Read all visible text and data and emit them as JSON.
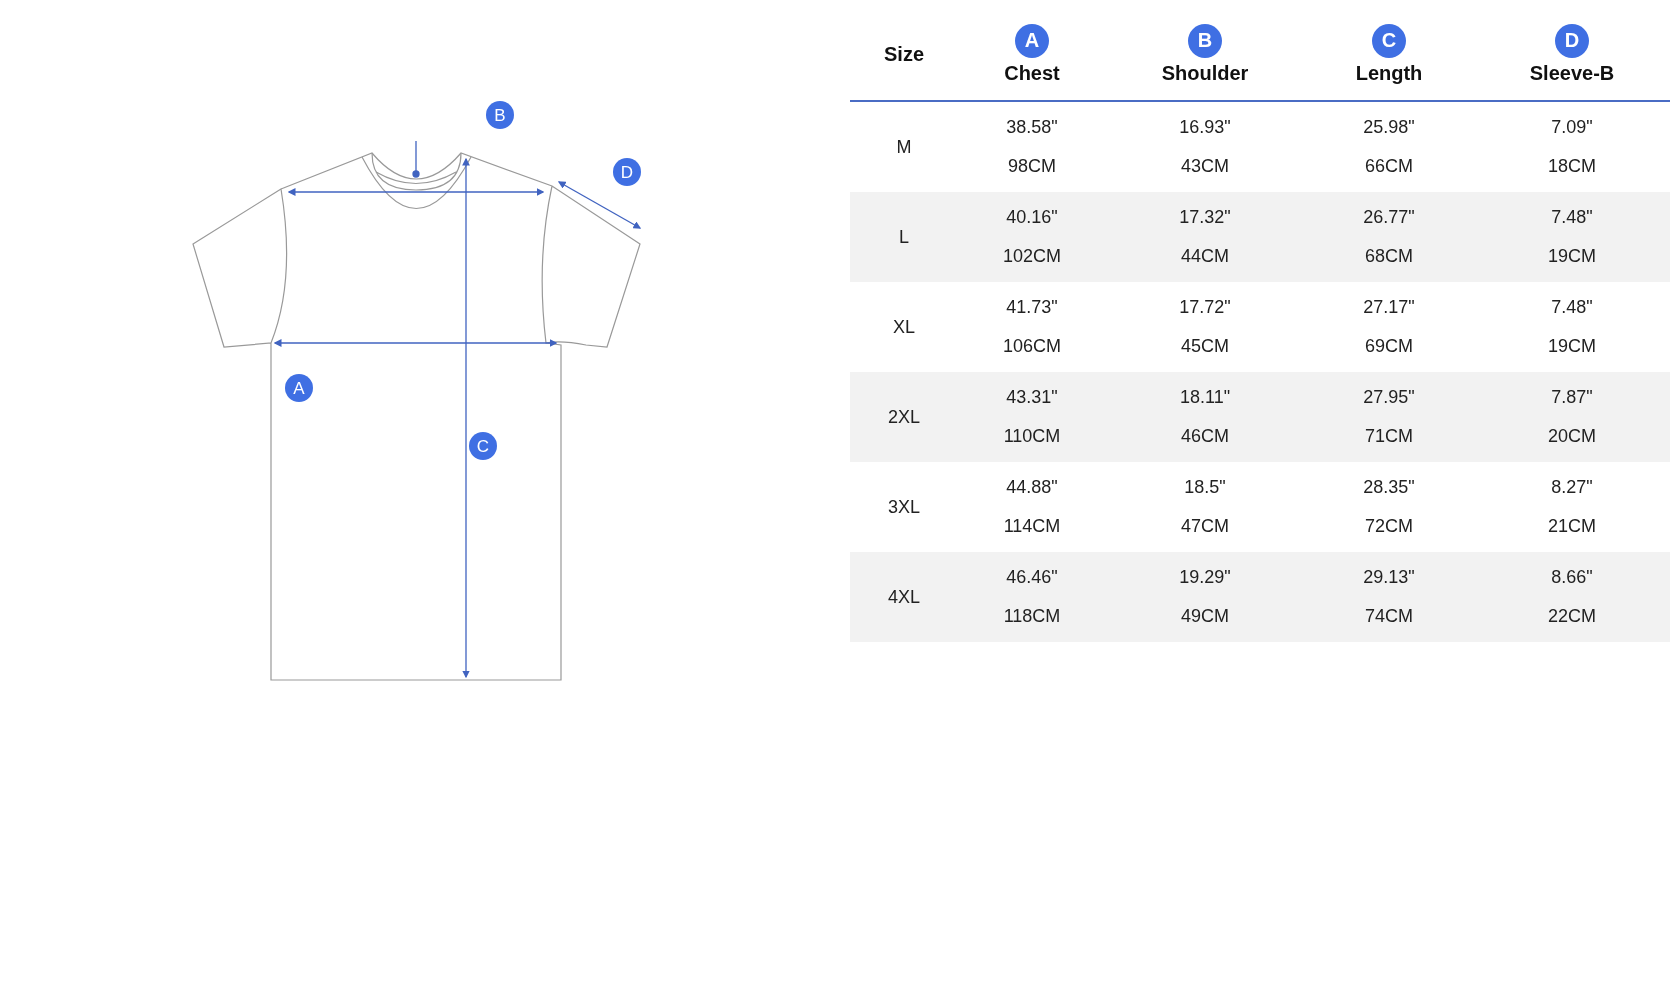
{
  "diagram": {
    "markers": [
      {
        "letter": "A"
      },
      {
        "letter": "B"
      },
      {
        "letter": "C"
      },
      {
        "letter": "D"
      }
    ]
  },
  "table": {
    "size_heading": "Size",
    "columns": [
      {
        "badge": "A",
        "label": "Chest"
      },
      {
        "badge": "B",
        "label": "Shoulder"
      },
      {
        "badge": "C",
        "label": "Length"
      },
      {
        "badge": "D",
        "label": "Sleeve-B"
      }
    ],
    "rows": [
      {
        "size": "M",
        "values": [
          {
            "inch": "38.58\"",
            "cm": "98CM"
          },
          {
            "inch": "16.93\"",
            "cm": "43CM"
          },
          {
            "inch": "25.98\"",
            "cm": "66CM"
          },
          {
            "inch": "7.09\"",
            "cm": "18CM"
          }
        ]
      },
      {
        "size": "L",
        "values": [
          {
            "inch": "40.16\"",
            "cm": "102CM"
          },
          {
            "inch": "17.32\"",
            "cm": "44CM"
          },
          {
            "inch": "26.77\"",
            "cm": "68CM"
          },
          {
            "inch": "7.48\"",
            "cm": "19CM"
          }
        ]
      },
      {
        "size": "XL",
        "values": [
          {
            "inch": "41.73\"",
            "cm": "106CM"
          },
          {
            "inch": "17.72\"",
            "cm": "45CM"
          },
          {
            "inch": "27.17\"",
            "cm": "69CM"
          },
          {
            "inch": "7.48\"",
            "cm": "19CM"
          }
        ]
      },
      {
        "size": "2XL",
        "values": [
          {
            "inch": "43.31\"",
            "cm": "110CM"
          },
          {
            "inch": "18.11\"",
            "cm": "46CM"
          },
          {
            "inch": "27.95\"",
            "cm": "71CM"
          },
          {
            "inch": "7.87\"",
            "cm": "20CM"
          }
        ]
      },
      {
        "size": "3XL",
        "values": [
          {
            "inch": "44.88\"",
            "cm": "114CM"
          },
          {
            "inch": "18.5\"",
            "cm": "47CM"
          },
          {
            "inch": "28.35\"",
            "cm": "72CM"
          },
          {
            "inch": "8.27\"",
            "cm": "21CM"
          }
        ]
      },
      {
        "size": "4XL",
        "values": [
          {
            "inch": "46.46\"",
            "cm": "118CM"
          },
          {
            "inch": "19.29\"",
            "cm": "49CM"
          },
          {
            "inch": "29.13\"",
            "cm": "74CM"
          },
          {
            "inch": "8.66\"",
            "cm": "22CM"
          }
        ]
      }
    ]
  }
}
